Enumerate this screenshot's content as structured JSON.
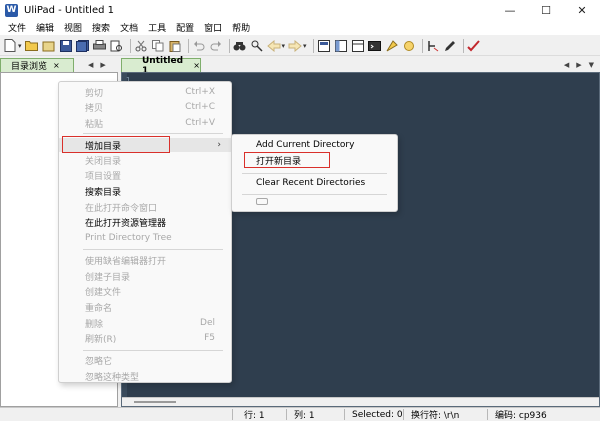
{
  "window": {
    "title": "UliPad - Untitled 1",
    "app_icon": "W",
    "minimize": "—",
    "maximize": "☐",
    "close": "✕"
  },
  "menubar": [
    "文件",
    "编辑",
    "视图",
    "搜索",
    "文档",
    "工具",
    "配置",
    "窗口",
    "帮助"
  ],
  "left_panel": {
    "tab_label": "目录浏览",
    "tab_close": "×"
  },
  "editor": {
    "tab_label": "Untitled 1",
    "tab_close": "×",
    "line_number": "1",
    "background": "#2f3e4e"
  },
  "context_menu": {
    "items": [
      {
        "label": "剪切",
        "shortcut": "Ctrl+X",
        "enabled": false
      },
      {
        "label": "拷贝",
        "shortcut": "Ctrl+C",
        "enabled": false
      },
      {
        "label": "粘贴",
        "shortcut": "Ctrl+V",
        "enabled": false
      },
      {
        "label": "增加目录",
        "shortcut": "",
        "enabled": true,
        "submenu": true
      },
      {
        "label": "关闭目录",
        "shortcut": "",
        "enabled": false
      },
      {
        "label": "项目设置",
        "shortcut": "",
        "enabled": false
      },
      {
        "label": "搜索目录",
        "shortcut": "",
        "enabled": true
      },
      {
        "label": "在此打开命令窗口",
        "shortcut": "",
        "enabled": false
      },
      {
        "label": "在此打开资源管理器",
        "shortcut": "",
        "enabled": true
      },
      {
        "label": "Print Directory Tree",
        "shortcut": "",
        "enabled": false
      },
      {
        "label": "使用缺省编辑器打开",
        "shortcut": "",
        "enabled": false
      },
      {
        "label": "创建子目录",
        "shortcut": "",
        "enabled": false
      },
      {
        "label": "创建文件",
        "shortcut": "",
        "enabled": false
      },
      {
        "label": "重命名",
        "shortcut": "",
        "enabled": false
      },
      {
        "label": "删除",
        "shortcut": "Del",
        "enabled": false
      },
      {
        "label": "刷新(R)",
        "shortcut": "F5",
        "enabled": false
      },
      {
        "label": "忽略它",
        "shortcut": "",
        "enabled": false
      },
      {
        "label": "忽略这种类型",
        "shortcut": "",
        "enabled": false
      }
    ],
    "submenu_arrow": "›"
  },
  "submenu": {
    "items": [
      {
        "label": "Add Current Directory"
      },
      {
        "label": "打开新目录"
      },
      {
        "label": "Clear Recent Directories"
      }
    ]
  },
  "statusbar": {
    "row": "行: 1",
    "col": "列: 1",
    "selected": "Selected: 0",
    "eol": "换行符: \\r\\n",
    "encoding": "编码: cp936"
  },
  "colors": {
    "highlight_box": "#d9302b",
    "tab_green": "#d9ecd0"
  }
}
